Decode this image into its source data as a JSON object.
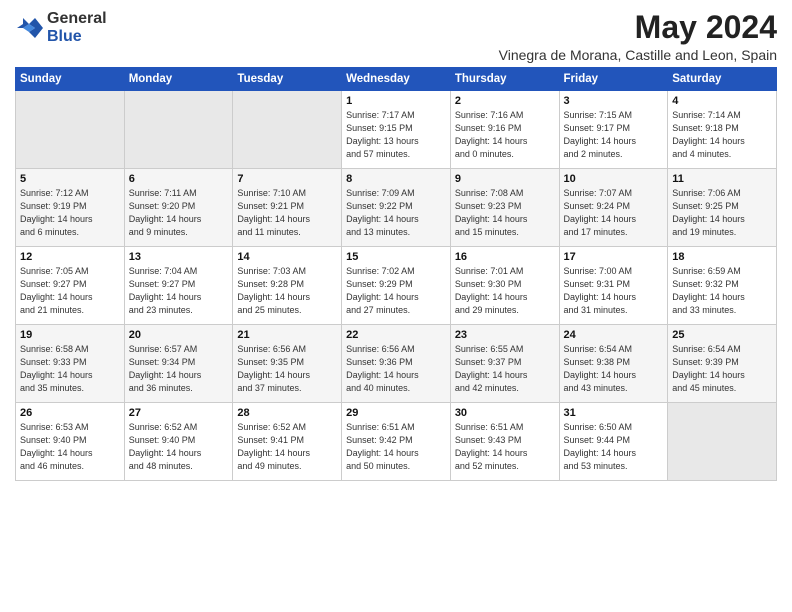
{
  "header": {
    "logo_general": "General",
    "logo_blue": "Blue",
    "title": "May 2024",
    "subtitle": "Vinegra de Morana, Castille and Leon, Spain"
  },
  "weekdays": [
    "Sunday",
    "Monday",
    "Tuesday",
    "Wednesday",
    "Thursday",
    "Friday",
    "Saturday"
  ],
  "weeks": [
    [
      {
        "day": "",
        "info": ""
      },
      {
        "day": "",
        "info": ""
      },
      {
        "day": "",
        "info": ""
      },
      {
        "day": "1",
        "info": "Sunrise: 7:17 AM\nSunset: 9:15 PM\nDaylight: 13 hours\nand 57 minutes."
      },
      {
        "day": "2",
        "info": "Sunrise: 7:16 AM\nSunset: 9:16 PM\nDaylight: 14 hours\nand 0 minutes."
      },
      {
        "day": "3",
        "info": "Sunrise: 7:15 AM\nSunset: 9:17 PM\nDaylight: 14 hours\nand 2 minutes."
      },
      {
        "day": "4",
        "info": "Sunrise: 7:14 AM\nSunset: 9:18 PM\nDaylight: 14 hours\nand 4 minutes."
      }
    ],
    [
      {
        "day": "5",
        "info": "Sunrise: 7:12 AM\nSunset: 9:19 PM\nDaylight: 14 hours\nand 6 minutes."
      },
      {
        "day": "6",
        "info": "Sunrise: 7:11 AM\nSunset: 9:20 PM\nDaylight: 14 hours\nand 9 minutes."
      },
      {
        "day": "7",
        "info": "Sunrise: 7:10 AM\nSunset: 9:21 PM\nDaylight: 14 hours\nand 11 minutes."
      },
      {
        "day": "8",
        "info": "Sunrise: 7:09 AM\nSunset: 9:22 PM\nDaylight: 14 hours\nand 13 minutes."
      },
      {
        "day": "9",
        "info": "Sunrise: 7:08 AM\nSunset: 9:23 PM\nDaylight: 14 hours\nand 15 minutes."
      },
      {
        "day": "10",
        "info": "Sunrise: 7:07 AM\nSunset: 9:24 PM\nDaylight: 14 hours\nand 17 minutes."
      },
      {
        "day": "11",
        "info": "Sunrise: 7:06 AM\nSunset: 9:25 PM\nDaylight: 14 hours\nand 19 minutes."
      }
    ],
    [
      {
        "day": "12",
        "info": "Sunrise: 7:05 AM\nSunset: 9:27 PM\nDaylight: 14 hours\nand 21 minutes."
      },
      {
        "day": "13",
        "info": "Sunrise: 7:04 AM\nSunset: 9:27 PM\nDaylight: 14 hours\nand 23 minutes."
      },
      {
        "day": "14",
        "info": "Sunrise: 7:03 AM\nSunset: 9:28 PM\nDaylight: 14 hours\nand 25 minutes."
      },
      {
        "day": "15",
        "info": "Sunrise: 7:02 AM\nSunset: 9:29 PM\nDaylight: 14 hours\nand 27 minutes."
      },
      {
        "day": "16",
        "info": "Sunrise: 7:01 AM\nSunset: 9:30 PM\nDaylight: 14 hours\nand 29 minutes."
      },
      {
        "day": "17",
        "info": "Sunrise: 7:00 AM\nSunset: 9:31 PM\nDaylight: 14 hours\nand 31 minutes."
      },
      {
        "day": "18",
        "info": "Sunrise: 6:59 AM\nSunset: 9:32 PM\nDaylight: 14 hours\nand 33 minutes."
      }
    ],
    [
      {
        "day": "19",
        "info": "Sunrise: 6:58 AM\nSunset: 9:33 PM\nDaylight: 14 hours\nand 35 minutes."
      },
      {
        "day": "20",
        "info": "Sunrise: 6:57 AM\nSunset: 9:34 PM\nDaylight: 14 hours\nand 36 minutes."
      },
      {
        "day": "21",
        "info": "Sunrise: 6:56 AM\nSunset: 9:35 PM\nDaylight: 14 hours\nand 37 minutes."
      },
      {
        "day": "22",
        "info": "Sunrise: 6:56 AM\nSunset: 9:36 PM\nDaylight: 14 hours\nand 40 minutes."
      },
      {
        "day": "23",
        "info": "Sunrise: 6:55 AM\nSunset: 9:37 PM\nDaylight: 14 hours\nand 42 minutes."
      },
      {
        "day": "24",
        "info": "Sunrise: 6:54 AM\nSunset: 9:38 PM\nDaylight: 14 hours\nand 43 minutes."
      },
      {
        "day": "25",
        "info": "Sunrise: 6:54 AM\nSunset: 9:39 PM\nDaylight: 14 hours\nand 45 minutes."
      }
    ],
    [
      {
        "day": "26",
        "info": "Sunrise: 6:53 AM\nSunset: 9:40 PM\nDaylight: 14 hours\nand 46 minutes."
      },
      {
        "day": "27",
        "info": "Sunrise: 6:52 AM\nSunset: 9:40 PM\nDaylight: 14 hours\nand 48 minutes."
      },
      {
        "day": "28",
        "info": "Sunrise: 6:52 AM\nSunset: 9:41 PM\nDaylight: 14 hours\nand 49 minutes."
      },
      {
        "day": "29",
        "info": "Sunrise: 6:51 AM\nSunset: 9:42 PM\nDaylight: 14 hours\nand 50 minutes."
      },
      {
        "day": "30",
        "info": "Sunrise: 6:51 AM\nSunset: 9:43 PM\nDaylight: 14 hours\nand 52 minutes."
      },
      {
        "day": "31",
        "info": "Sunrise: 6:50 AM\nSunset: 9:44 PM\nDaylight: 14 hours\nand 53 minutes."
      },
      {
        "day": "",
        "info": ""
      }
    ]
  ]
}
